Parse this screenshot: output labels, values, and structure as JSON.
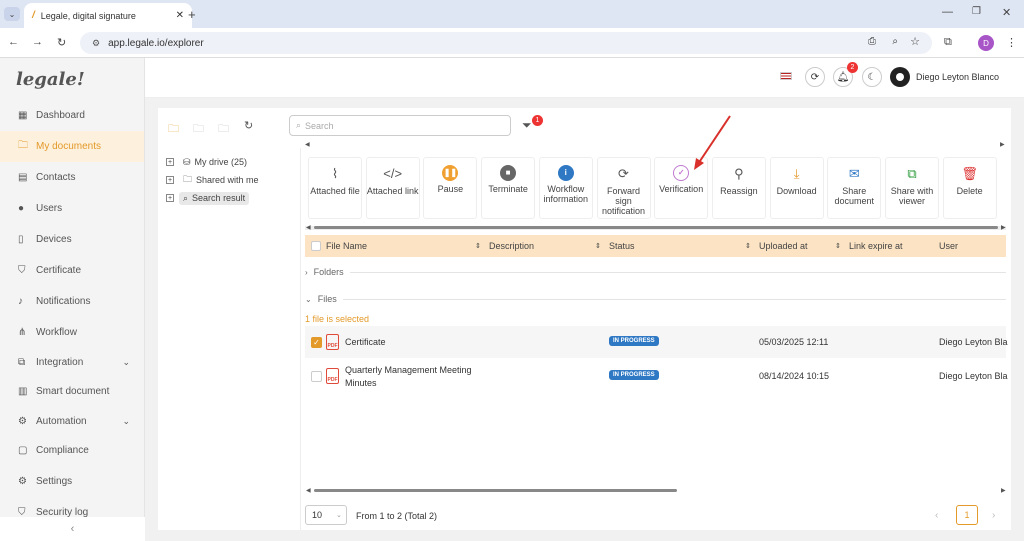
{
  "browser": {
    "tab_title": "Legale, digital signature",
    "url": "app.legale.io/explorer",
    "profile_initial": "D"
  },
  "brand": {
    "logo": "legale!"
  },
  "sidebar": {
    "items": [
      {
        "label": "Dashboard",
        "icon": "dashboard-icon"
      },
      {
        "label": "My documents",
        "icon": "folder-icon"
      },
      {
        "label": "Contacts",
        "icon": "contacts-icon"
      },
      {
        "label": "Users",
        "icon": "user-icon"
      },
      {
        "label": "Devices",
        "icon": "device-icon"
      },
      {
        "label": "Certificate",
        "icon": "shield-icon"
      },
      {
        "label": "Notifications",
        "icon": "bell-icon"
      },
      {
        "label": "Workflow",
        "icon": "workflow-icon"
      },
      {
        "label": "Integration",
        "icon": "integration-icon"
      },
      {
        "label": "Smart document",
        "icon": "smart-document-icon"
      },
      {
        "label": "Automation",
        "icon": "automation-icon"
      },
      {
        "label": "Compliance",
        "icon": "compliance-icon"
      },
      {
        "label": "Settings",
        "icon": "gear-icon"
      },
      {
        "label": "Security log",
        "icon": "security-log-icon"
      }
    ]
  },
  "header": {
    "notification_count": "2",
    "user_name": "Diego Leyton Blanco"
  },
  "explorer": {
    "search_placeholder": "Search",
    "filter_count": "1",
    "tree": [
      {
        "label": "My drive (25)"
      },
      {
        "label": "Shared with me"
      },
      {
        "label": "Search result"
      }
    ],
    "toolbar": [
      {
        "label": "Attached file",
        "icon": "paperclip-icon"
      },
      {
        "label": "Attached link",
        "icon": "code-icon"
      },
      {
        "label": "Pause",
        "icon": "pause-icon"
      },
      {
        "label": "Terminate",
        "icon": "stop-icon"
      },
      {
        "label": "Workflow information",
        "icon": "info-icon"
      },
      {
        "label": "Forward sign notification",
        "icon": "refresh-icon"
      },
      {
        "label": "Verification",
        "icon": "check-circle-icon"
      },
      {
        "label": "Reassign",
        "icon": "reassign-icon"
      },
      {
        "label": "Download",
        "icon": "download-icon"
      },
      {
        "label": "Share document",
        "icon": "mail-icon"
      },
      {
        "label": "Share with viewer",
        "icon": "share-viewer-icon"
      },
      {
        "label": "Delete",
        "icon": "trash-icon"
      }
    ],
    "columns": [
      "File Name",
      "Description",
      "Status",
      "Uploaded at",
      "Link expire at",
      "User"
    ],
    "sections": {
      "folders": "Folders",
      "files": "Files"
    },
    "selection_text": "1 file is selected",
    "rows": [
      {
        "name": "Certificate",
        "status": "IN PROGRESS",
        "uploaded": "05/03/2025 12:11",
        "user": "Diego Leyton Bla"
      },
      {
        "name": "Quarterly Management Meeting Minutes",
        "status": "IN PROGRESS",
        "uploaded": "08/14/2024 10:15",
        "user": "Diego Leyton Bla"
      }
    ],
    "page_size": "10",
    "pagination_text": "From 1 to 2 (Total 2)",
    "current_page": "1"
  },
  "colors": {
    "accent": "#e39a2a",
    "badge": "#2f78c4",
    "header_row": "#fbe3c3",
    "arrow": "#d9302b"
  }
}
